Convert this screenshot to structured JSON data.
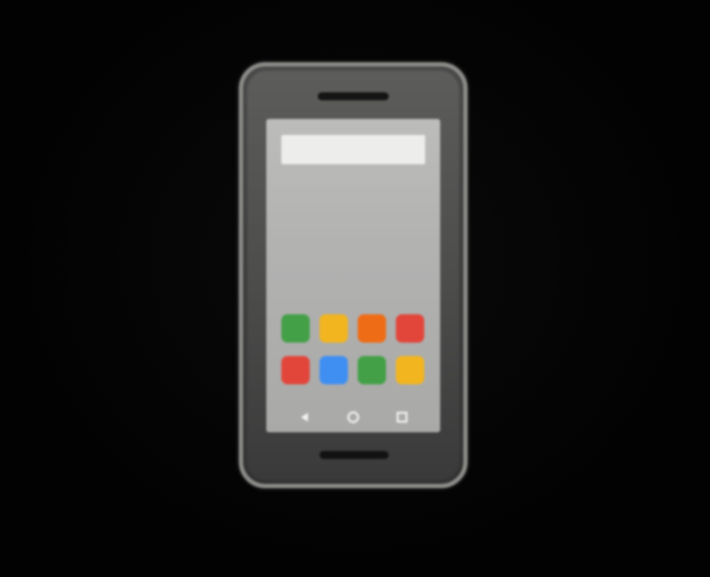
{
  "device": {
    "type": "smartphone",
    "screen": {
      "search_bar": {
        "value": ""
      },
      "app_icons": [
        {
          "icon": "app-icon",
          "color": "#43a047"
        },
        {
          "icon": "app-icon",
          "color": "#f2b51f"
        },
        {
          "icon": "app-icon",
          "color": "#ef6c16"
        },
        {
          "icon": "app-icon",
          "color": "#e2463b"
        },
        {
          "icon": "app-icon",
          "color": "#e2463b"
        },
        {
          "icon": "app-icon",
          "color": "#3f8ff2"
        },
        {
          "icon": "app-icon",
          "color": "#43a047"
        },
        {
          "icon": "app-icon",
          "color": "#f2b51f"
        }
      ],
      "nav_buttons": [
        {
          "icon": "back-triangle-icon"
        },
        {
          "icon": "home-circle-icon"
        },
        {
          "icon": "recents-square-icon"
        }
      ]
    }
  },
  "colors": {
    "background": "#020202",
    "phone_body": "#4d4d4c",
    "phone_frame": "#8a8a87",
    "screen": "#b4b4b3",
    "search_bar": "#ededec"
  }
}
